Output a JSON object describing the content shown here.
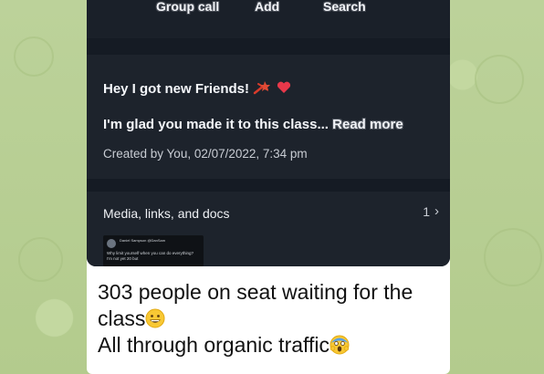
{
  "actions": {
    "group_call": "Group call",
    "add": "Add",
    "search": "Search"
  },
  "group_info": {
    "title": "Hey I got new Friends!",
    "description": "I'm glad you made it to this class...",
    "read_more": "Read more",
    "created": "Created by You, 02/07/2022, 7:34 pm"
  },
  "media": {
    "label": "Media, links, and docs",
    "count": "1",
    "thumb_name": "Daniel Sampson",
    "thumb_handle": "@DanSam",
    "thumb_text": "Why limit yourself when you can do everything? I'm not yet 20 but"
  },
  "caption": {
    "line1": "303 people on seat waiting for the",
    "line2": "class",
    "line3": "All through organic traffic"
  }
}
